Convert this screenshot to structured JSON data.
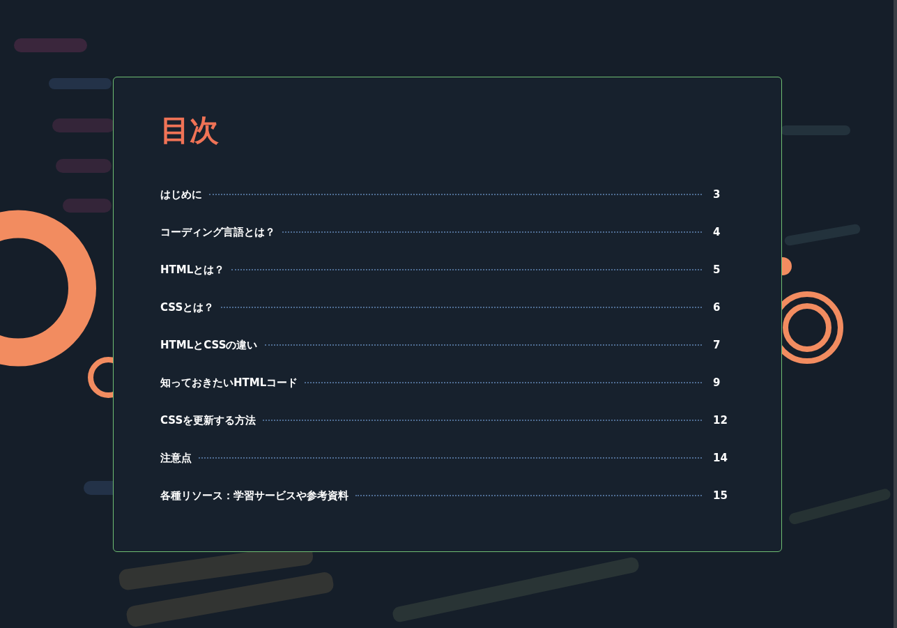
{
  "toc": {
    "title": "目次",
    "entries": [
      {
        "label": "はじめに",
        "page": "3"
      },
      {
        "label": "コーディング言語とは？",
        "page": "4"
      },
      {
        "label": "HTMLとは？",
        "page": "5"
      },
      {
        "label": "CSSとは？",
        "page": "6"
      },
      {
        "label": "HTMLとCSSの違い",
        "page": "7"
      },
      {
        "label": "知っておきたいHTMLコード",
        "page": "9"
      },
      {
        "label": "CSSを更新する方法",
        "page": "12"
      },
      {
        "label": "注意点",
        "page": "14"
      },
      {
        "label": "各種リソース：学習サービスや参考資料",
        "page": "15"
      }
    ]
  }
}
